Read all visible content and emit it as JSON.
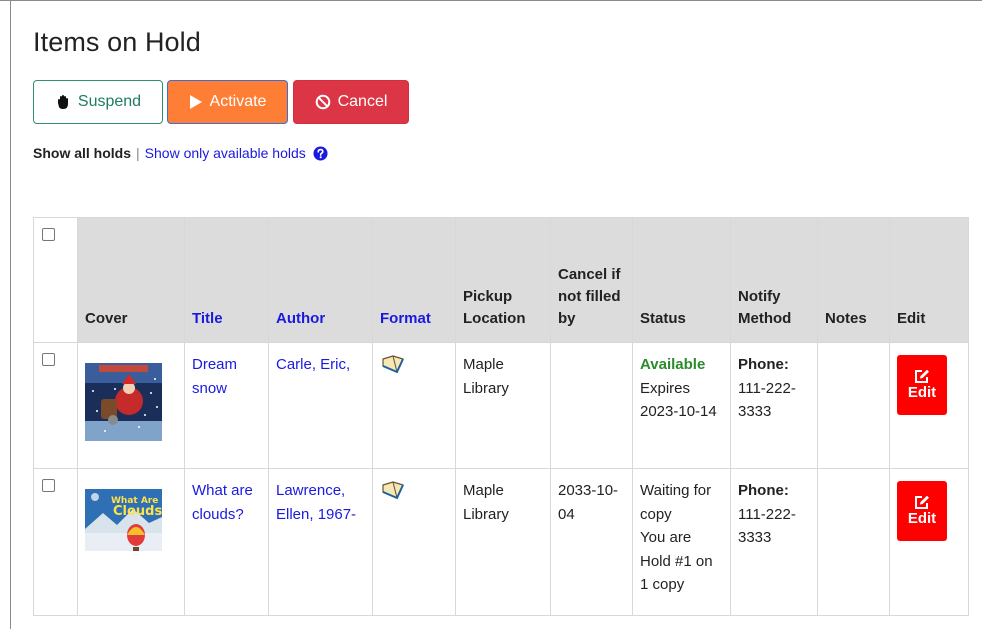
{
  "page": {
    "title": "Items on Hold"
  },
  "toolbar": {
    "suspend_label": "Suspend",
    "activate_label": "Activate",
    "cancel_label": "Cancel"
  },
  "filter": {
    "show_all": "Show all holds",
    "separator": "|",
    "show_available": "Show only available holds"
  },
  "table": {
    "headers": {
      "cover": "Cover",
      "title": "Title",
      "author": "Author",
      "format": "Format",
      "pickup": "Pickup Location",
      "cancel_by": "Cancel if not filled by",
      "status": "Status",
      "notify": "Notify Method",
      "notes": "Notes",
      "edit": "Edit"
    },
    "rows": [
      {
        "title": "Dream snow",
        "author": "Carle, Eric,",
        "format_icon": "book-icon",
        "pickup": "Maple Library",
        "cancel_by": "",
        "status_primary": "Available",
        "status_secondary": "Expires 2023-10-14",
        "notify_label": "Phone:",
        "notify_value": "111-222-3333",
        "notes": "",
        "edit_label": "Edit"
      },
      {
        "title": "What are clouds?",
        "author": "Lawrence, Ellen, 1967-",
        "format_icon": "book-icon",
        "pickup": "Maple Library",
        "cancel_by": "2033-10-04",
        "status_primary": "Waiting for copy",
        "status_secondary": "You are Hold #1 on 1 copy",
        "notify_label": "Phone:",
        "notify_value": "111-222-3333",
        "notes": "",
        "edit_label": "Edit"
      }
    ]
  },
  "colors": {
    "suspend": "#1e7b62",
    "activate": "#fd7e34",
    "cancel": "#dc3545",
    "edit": "#ff0000",
    "link": "#1a1adf",
    "available": "#2d8a2d"
  }
}
